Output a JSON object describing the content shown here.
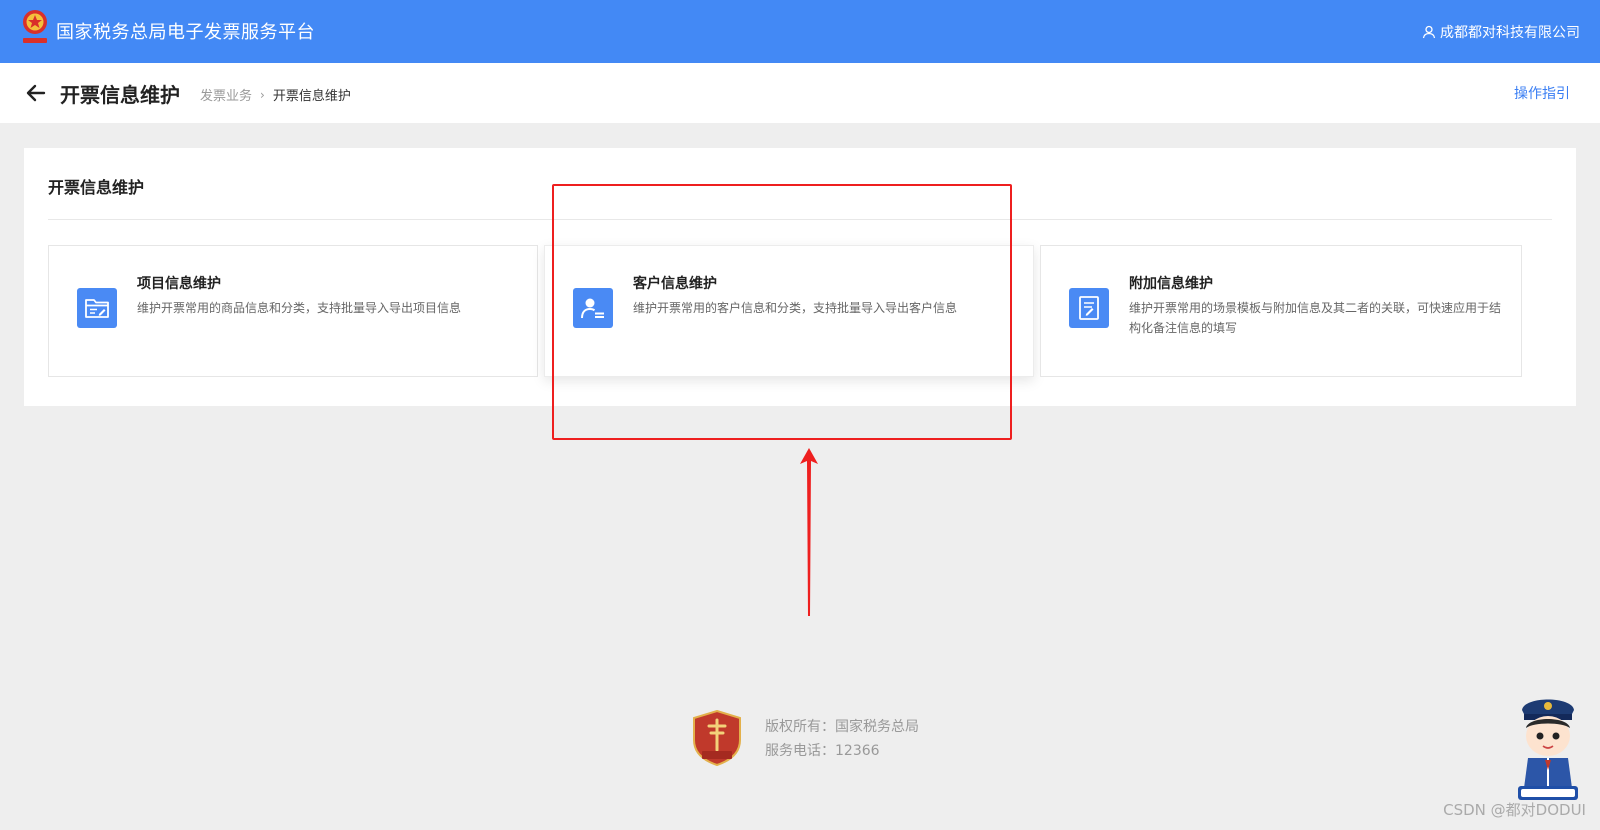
{
  "header": {
    "app_title": "国家税务总局电子发票服务平台",
    "user_name": "成都都对科技有限公司",
    "bg_color": "#4389f5"
  },
  "subheader": {
    "page_title": "开票信息维护",
    "breadcrumb": [
      "发票业务",
      "开票信息维护"
    ],
    "guide_label": "操作指引"
  },
  "panel": {
    "title": "开票信息维护",
    "cards": [
      {
        "title": "项目信息维护",
        "desc": "维护开票常用的商品信息和分类，支持批量导入导出项目信息",
        "icon": "folder-edit-icon"
      },
      {
        "title": "客户信息维护",
        "desc": "维护开票常用的客户信息和分类，支持批量导入导出客户信息",
        "icon": "user-card-icon"
      },
      {
        "title": "附加信息维护",
        "desc": "维护开票常用的场景模板与附加信息及其二者的关联，可快速应用于结构化备注信息的填写",
        "icon": "document-edit-icon"
      }
    ]
  },
  "footer": {
    "copyright": "版权所有：国家税务总局",
    "phone": "服务电话：12366"
  },
  "watermark": "CSDN @都对DODUI",
  "colors": {
    "accent": "#4a8af4",
    "highlight": "#ee1f1f",
    "page_bg": "#eeeeee"
  }
}
